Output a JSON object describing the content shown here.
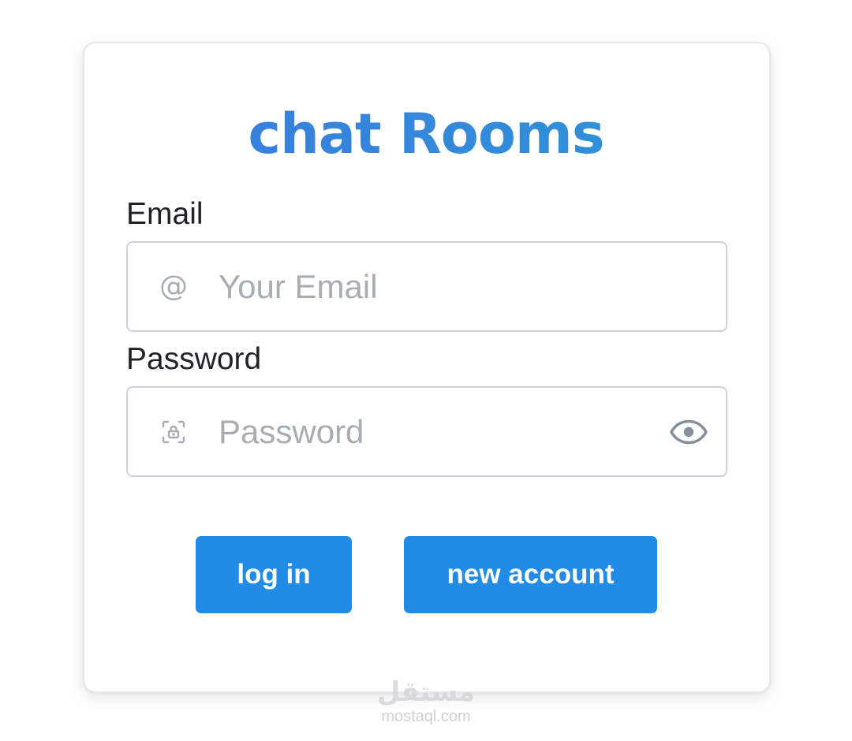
{
  "app": {
    "title": "chat Rooms"
  },
  "email": {
    "label": "Email",
    "icon": "at-icon",
    "placeholder": "Your Email",
    "value": ""
  },
  "password": {
    "label": "Password",
    "icon": "lock-icon",
    "placeholder": "Password",
    "value": "",
    "toggle_icon": "eye-icon"
  },
  "actions": {
    "login_label": "log in",
    "new_account_label": "new account"
  },
  "watermark": {
    "logo": "مستقل",
    "domain": "mostaql.com"
  },
  "colors": {
    "accent": "#228be6",
    "title_gradient_start": "#3f74e3",
    "title_gradient_end": "#2a9bd2",
    "text": "#1f2329",
    "placeholder": "#a8adb3",
    "border": "#ced4da"
  }
}
